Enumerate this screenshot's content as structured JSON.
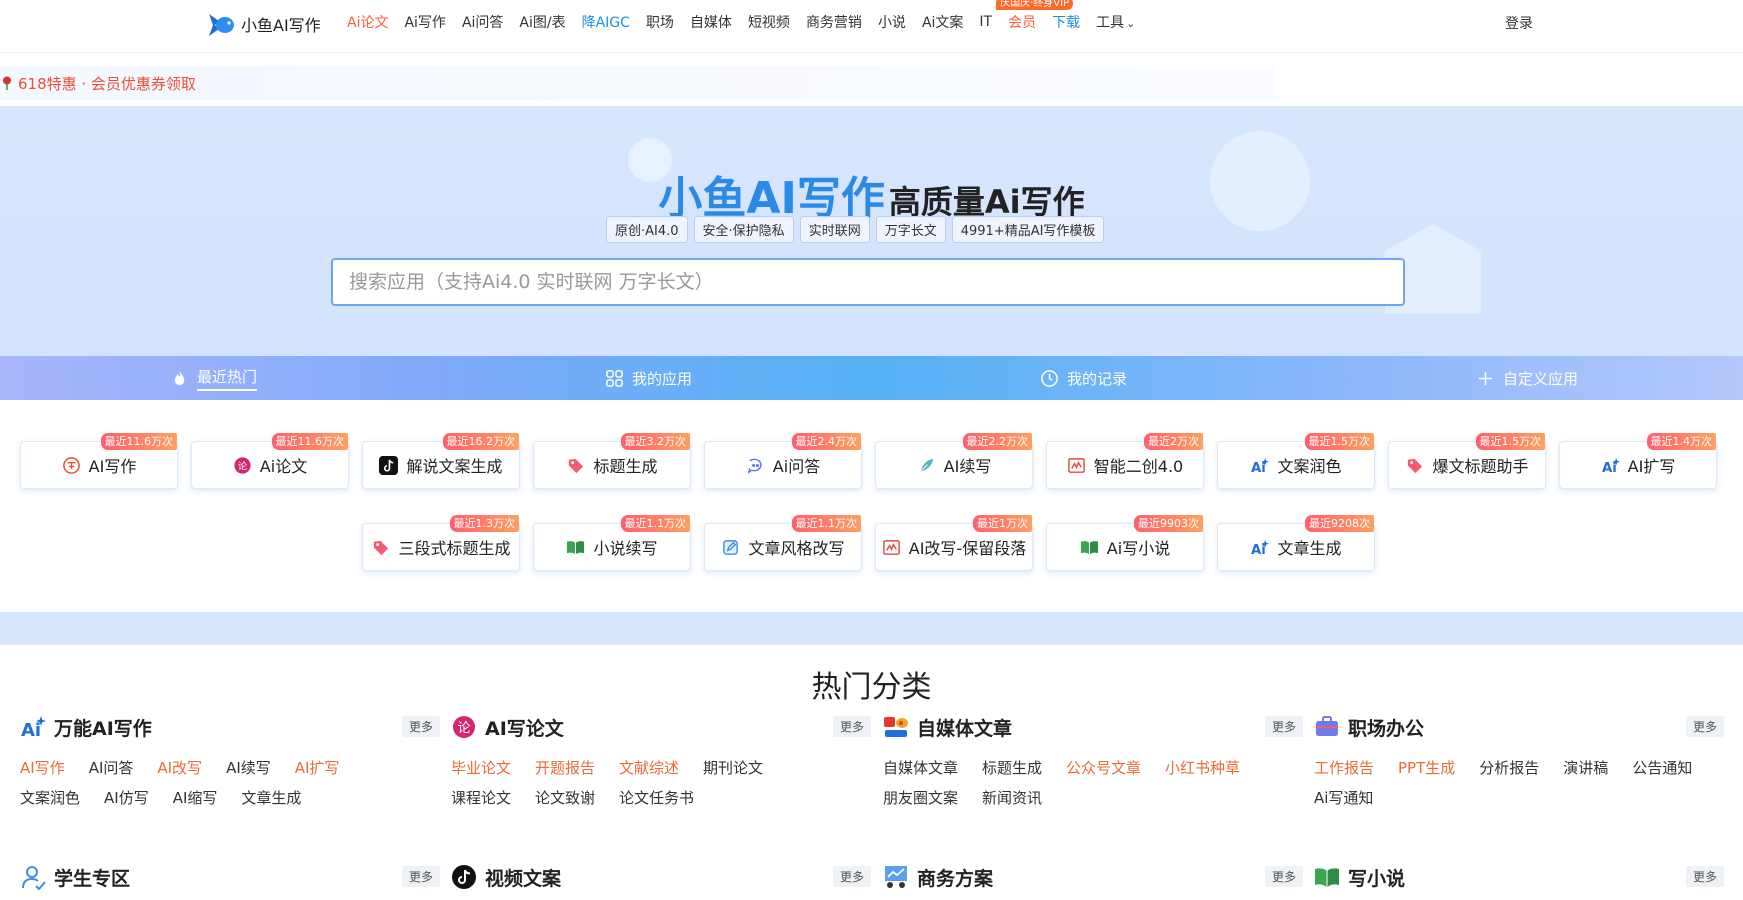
{
  "header": {
    "logo_text": "小鱼AI写作",
    "nav": [
      {
        "label": "Ai论文",
        "style": "active"
      },
      {
        "label": "Ai写作",
        "style": ""
      },
      {
        "label": "Ai问答",
        "style": ""
      },
      {
        "label": "Ai图/表",
        "style": ""
      },
      {
        "label": "降AIGC",
        "style": "blue"
      },
      {
        "label": "职场",
        "style": ""
      },
      {
        "label": "自媒体",
        "style": ""
      },
      {
        "label": "短视频",
        "style": ""
      },
      {
        "label": "商务营销",
        "style": ""
      },
      {
        "label": "小说",
        "style": ""
      },
      {
        "label": "Ai文案",
        "style": ""
      },
      {
        "label": "IT",
        "style": ""
      },
      {
        "label": "会员",
        "style": "vip"
      },
      {
        "label": "下载",
        "style": "blue"
      },
      {
        "label": "工具",
        "style": "dropdown"
      }
    ],
    "vip_badge": "庆国庆·终身VIP",
    "login": "登录"
  },
  "notice": {
    "text": "618特惠 · 会员优惠券领取"
  },
  "hero": {
    "brand": "小鱼AI写作",
    "subtitle": "高质量Ai写作",
    "tags": [
      "原创·AI4.0",
      "安全·保护隐私",
      "实时联网",
      "万字长文",
      "4991+精品AI写作模板"
    ],
    "search_placeholder": "搜索应用（支持Ai4.0 实时联网 万字长文）"
  },
  "tabs": [
    {
      "label": "最近热门",
      "icon": "flame-icon"
    },
    {
      "label": "我的应用",
      "icon": "grid-icon"
    },
    {
      "label": "我的记录",
      "icon": "clock-icon"
    },
    {
      "label": "自定义应用",
      "icon": "plus-icon"
    }
  ],
  "apps": [
    {
      "label": "AI写作",
      "badge": "最近11.6万次",
      "icon": "ai-write-icon"
    },
    {
      "label": "Ai论文",
      "badge": "最近11.6万次",
      "icon": "paper-icon"
    },
    {
      "label": "解说文案生成",
      "badge": "最近16.2万次",
      "icon": "tiktok-icon"
    },
    {
      "label": "标题生成",
      "badge": "最近3.2万次",
      "icon": "tag-icon"
    },
    {
      "label": "Ai问答",
      "badge": "最近2.4万次",
      "icon": "chat-icon"
    },
    {
      "label": "AI续写",
      "badge": "最近2.2万次",
      "icon": "feather-icon"
    },
    {
      "label": "智能二创4.0",
      "badge": "最近2万次",
      "icon": "rewrite-icon"
    },
    {
      "label": "文案润色",
      "badge": "最近1.5万次",
      "icon": "ai-spark-icon"
    },
    {
      "label": "爆文标题助手",
      "badge": "最近1.5万次",
      "icon": "tag-icon"
    },
    {
      "label": "AI扩写",
      "badge": "最近1.4万次",
      "icon": "ai-spark-icon"
    },
    {
      "label": "三段式标题生成",
      "badge": "最近1.3万次",
      "icon": "tag-icon"
    },
    {
      "label": "小说续写",
      "badge": "最近1.1万次",
      "icon": "book-icon"
    },
    {
      "label": "文章风格改写",
      "badge": "最近1.1万次",
      "icon": "edit-icon"
    },
    {
      "label": "AI改写-保留段落",
      "badge": "最近1万次",
      "icon": "rewrite-icon"
    },
    {
      "label": "Ai写小说",
      "badge": "最近9903次",
      "icon": "book-icon"
    },
    {
      "label": "文章生成",
      "badge": "最近9208次",
      "icon": "ai-spark-icon"
    }
  ],
  "categories_title": "热门分类",
  "categories": [
    {
      "name": "万能AI写作",
      "icon": "ai-spark-icon",
      "more": "更多",
      "links": [
        {
          "label": "AI写作",
          "hot": true
        },
        {
          "label": "AI问答",
          "hot": false
        },
        {
          "label": "AI改写",
          "hot": true
        },
        {
          "label": "AI续写",
          "hot": false
        },
        {
          "label": "AI扩写",
          "hot": true
        },
        {
          "label": "文案润色",
          "hot": false
        },
        {
          "label": "AI仿写",
          "hot": false
        },
        {
          "label": "AI缩写",
          "hot": false
        },
        {
          "label": "文章生成",
          "hot": false
        }
      ]
    },
    {
      "name": "AI写论文",
      "icon": "paper-icon",
      "more": "更多",
      "links": [
        {
          "label": "毕业论文",
          "hot": true
        },
        {
          "label": "开题报告",
          "hot": true
        },
        {
          "label": "文献综述",
          "hot": true
        },
        {
          "label": "期刊论文",
          "hot": false
        },
        {
          "label": "课程论文",
          "hot": false
        },
        {
          "label": "论文致谢",
          "hot": false
        },
        {
          "label": "论文任务书",
          "hot": false
        }
      ]
    },
    {
      "name": "自媒体文章",
      "icon": "weibo-icon",
      "more": "更多",
      "links": [
        {
          "label": "自媒体文章",
          "hot": false
        },
        {
          "label": "标题生成",
          "hot": false
        },
        {
          "label": "公众号文章",
          "hot": true
        },
        {
          "label": "小红书种草",
          "hot": true
        },
        {
          "label": "朋友圈文案",
          "hot": false
        },
        {
          "label": "新闻资讯",
          "hot": false
        }
      ]
    },
    {
      "name": "职场办公",
      "icon": "briefcase-icon",
      "more": "更多",
      "links": [
        {
          "label": "工作报告",
          "hot": true
        },
        {
          "label": "PPT生成",
          "hot": true
        },
        {
          "label": "分析报告",
          "hot": false
        },
        {
          "label": "演讲稿",
          "hot": false
        },
        {
          "label": "公告通知",
          "hot": false
        },
        {
          "label": "Ai写通知",
          "hot": false
        }
      ]
    },
    {
      "name": "学生专区",
      "icon": "student-icon",
      "more": "更多",
      "links": []
    },
    {
      "name": "视频文案",
      "icon": "tiktok-icon",
      "more": "更多",
      "links": []
    },
    {
      "name": "商务方案",
      "icon": "business-icon",
      "more": "更多",
      "links": []
    },
    {
      "name": "写小说",
      "icon": "book-icon",
      "more": "更多",
      "links": []
    }
  ]
}
